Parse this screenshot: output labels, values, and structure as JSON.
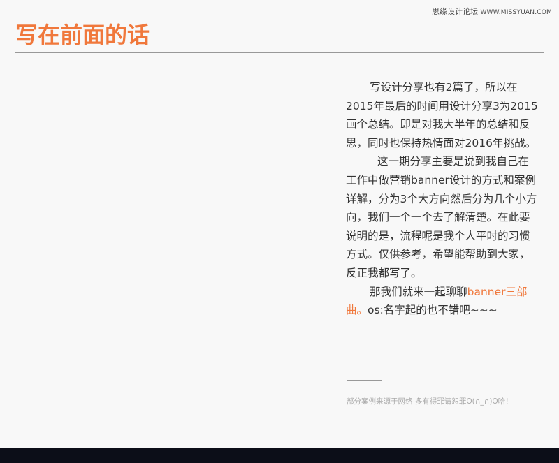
{
  "watermark": {
    "site_name": "思缘设计论坛",
    "url": "WWW.MISSYUAN.COM"
  },
  "title": "写在前面的话",
  "paragraphs": {
    "p1": "写设计分享也有2篇了，所以在2015年最后的时间用设计分享3为2015画个总结。即是对我大半年的总结和反思，同时也保持热情面对2016年挑战。",
    "p2": "这一期分享主要是说到我自己在工作中做营销banner设计的方式和案例详解，分为3个大方向然后分为几个小方向，我们一个一个去了解清楚。在此要说明的是，流程呢是我个人平时的习惯方式。仅供参考，希望能帮助到大家，反正我都写了。",
    "p3_lead": "那我们就来一起聊聊",
    "p3_highlight": "banner三部曲。",
    "p3_tail": "os:名字起的也不错吧~~~"
  },
  "note": "部分案例来源于网络 多有得罪请恕罪O(∩_∩)O哈！",
  "colors": {
    "accent": "#f0783c",
    "footer": "#0c0e18",
    "background": "#f8f8f8"
  }
}
